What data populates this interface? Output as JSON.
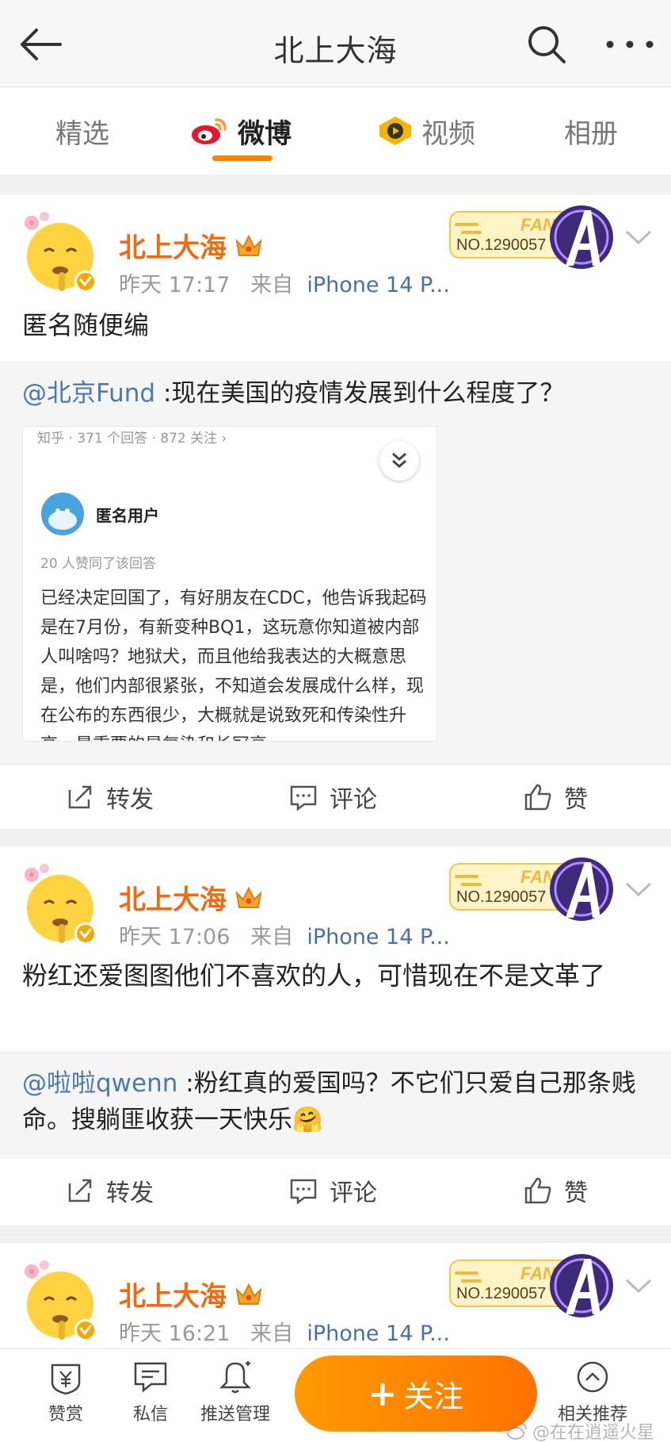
{
  "header": {
    "title": "北上大海"
  },
  "tabs": [
    {
      "label": "精选"
    },
    {
      "label": "微博"
    },
    {
      "label": "视频"
    },
    {
      "label": "相册"
    }
  ],
  "fans_badge": {
    "label": "FANS",
    "number": "NO.1290057"
  },
  "posts": [
    {
      "username": "北上大海",
      "time": "昨天 17:17",
      "from": "来自",
      "device": "iPhone 14 P...",
      "text": "匿名随便编",
      "repost": {
        "mention": "@北京Fund",
        "text": " :现在美国的疫情发展到什么程度了？",
        "zhihu": {
          "top": "知乎 · 371 个回答 · 872 关注 ›",
          "user": "匿名用户",
          "likes": "20 人赞同了该回答",
          "body": "已经决定回国了，有好朋友在CDC，他告诉我起码是在7月份，有新变种BQ1，这玩意你知道被内部人叫啥吗？地狱犬，而且他给我表达的大概意思是，他们内部很紧张，不知道会发展成什么样，现在公布的东西很少，大概就是说致死和传染性升高，最重要的是复染和长冠衰"
        }
      },
      "actions": {
        "repost": "转发",
        "comment": "评论",
        "like": "赞"
      }
    },
    {
      "username": "北上大海",
      "time": "昨天 17:06",
      "from": "来自",
      "device": "iPhone 14 P...",
      "text": "粉红还爱图图他们不喜欢的人，可惜现在不是文革了",
      "repost": {
        "mention": "@啦啦qwenn",
        "text": " :粉红真的爱国吗？不它们只爱自己那条贱命。搜躺匪收获一天快乐🤗"
      },
      "actions": {
        "repost": "转发",
        "comment": "评论",
        "like": "赞"
      }
    },
    {
      "username": "北上大海",
      "time": "昨天 16:21",
      "from": "来自",
      "device": "iPhone 14 P..."
    }
  ],
  "bottom_bar": {
    "reward": "赞赏",
    "message": "私信",
    "push": "推送管理",
    "follow": "关注",
    "follow_plus": "+",
    "related": "相关推荐"
  },
  "watermark": "@在在逍遥火星"
}
